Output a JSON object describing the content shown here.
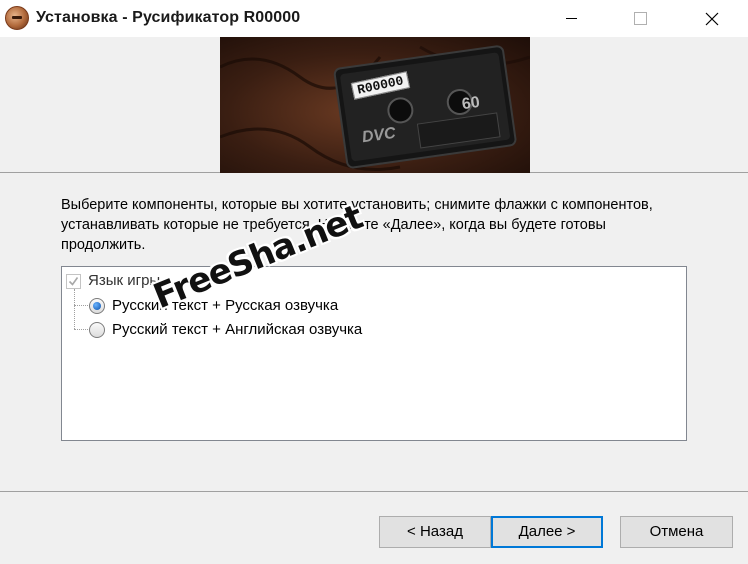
{
  "window": {
    "title": "Установка - Русификатор R00000",
    "icon": "installer-app-icon",
    "controls": [
      "minimize-icon",
      "maximize-icon",
      "close-icon"
    ]
  },
  "banner": {
    "image": "dv-cassette-photo",
    "cassette_label": "R00000",
    "cassette_length": "60",
    "cassette_format": "DVC"
  },
  "page": {
    "description": "Выберите компоненты, которые вы хотите установить; снимите флажки с компонентов, устанавливать которые не требуется. Нажмите «Далее», когда вы будете готовы продолжить."
  },
  "components": {
    "group": {
      "label": "Язык игры",
      "checked": true,
      "disabled": true
    },
    "options": [
      {
        "label": "Русский текст + Русская озвучка",
        "selected": true
      },
      {
        "label": "Русский текст + Английская озвучка",
        "selected": false
      }
    ]
  },
  "watermark": "FreeSha.net",
  "buttons": {
    "back": "< Назад",
    "next": "Далее >",
    "cancel": "Отмена"
  },
  "colors": {
    "accent": "#0078d7",
    "window_bg": "#f0f0f0",
    "list_bg": "#ffffff"
  }
}
